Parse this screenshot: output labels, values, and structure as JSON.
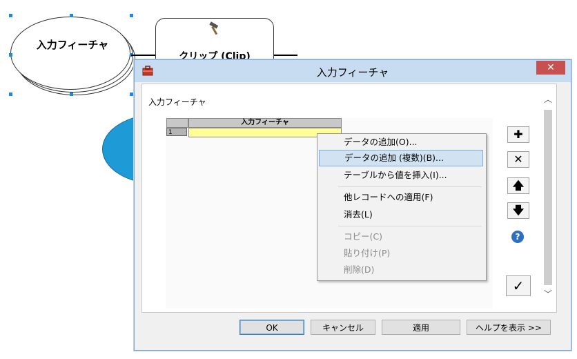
{
  "model": {
    "input_node_label": "入力フィーチャ",
    "tool_node_label": "クリップ (Clip)",
    "tool_icon": "hammer-icon"
  },
  "dialog": {
    "title": "入力フィーチャ",
    "close_glyph": "✕",
    "field_label": "入力フィーチャ",
    "table": {
      "column_header": "入力フィーチャ",
      "rows": [
        {
          "num": "1",
          "value": ""
        }
      ]
    },
    "side_buttons": {
      "add": "✚",
      "delete": "✕",
      "up": "🡅",
      "down": "🡇",
      "help": "?",
      "check": "✓"
    },
    "buttons": {
      "ok": "OK",
      "cancel": "キャンセル",
      "apply": "適用",
      "help": "ヘルプを表示 >>"
    }
  },
  "context_menu": {
    "items": [
      {
        "label": "データの追加(O)...",
        "state": "normal"
      },
      {
        "label": "データの追加 (複数)(B)...",
        "state": "highlighted"
      },
      {
        "label": "テーブルから値を挿入(I)...",
        "state": "normal"
      },
      {
        "label": "他レコードへの適用(F)",
        "state": "normal"
      },
      {
        "label": "消去(L)",
        "state": "normal"
      },
      {
        "label": "コピー(C)",
        "state": "disabled"
      },
      {
        "label": "貼り付け(P)",
        "state": "disabled"
      },
      {
        "label": "削除(D)",
        "state": "disabled"
      }
    ]
  },
  "colors": {
    "highlight": "#d1e2f2",
    "input_cell": "#ffff99",
    "close_button": "#c75050",
    "titlebar": "#c8dcf1",
    "variable_node": "#1e9bd6"
  }
}
